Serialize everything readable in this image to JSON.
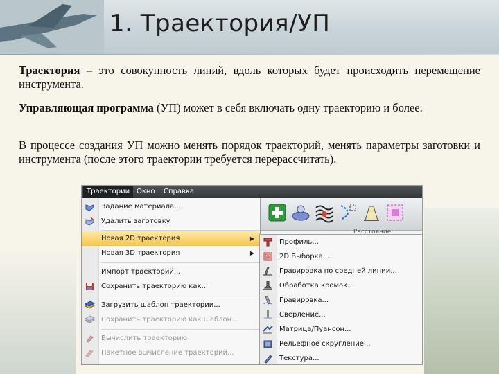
{
  "slide": {
    "title": "1. Траектория/УП",
    "paragraphs": [
      {
        "term": "Траектория",
        "text": " – это совокупность линий, вдоль которых будет происходить перемещение инструмента."
      },
      {
        "term": "Управляющая программа",
        "text": " (УП) может в себя включать одну траекторию и более."
      },
      {
        "term": "",
        "text": "В процессе создания УП можно менять порядок траекторий, менять параметры заготовки и инструмента (после этого траектории требуется перерассчитать)."
      }
    ]
  },
  "app": {
    "menubar": [
      "Траектории",
      "Окно",
      "Справка"
    ],
    "toolbar_label": "Расстояние",
    "menu": [
      {
        "label": "Задание материала...",
        "icon": "material-icon",
        "enabled": true
      },
      {
        "label": "Удалить заготовку",
        "icon": "delete-blank-icon",
        "enabled": true
      },
      {
        "label": "Новая 2D траектория",
        "icon": "",
        "enabled": true,
        "submenu": true,
        "highlighted": true
      },
      {
        "label": "Новая 3D траектория",
        "icon": "",
        "enabled": true,
        "submenu": true
      },
      {
        "label": "Импорт траекторий...",
        "icon": "",
        "enabled": true
      },
      {
        "label": "Сохранить траекторию как...",
        "icon": "save-icon",
        "enabled": true
      },
      {
        "label": "Загрузить шаблон траектории...",
        "icon": "load-template-icon",
        "enabled": true
      },
      {
        "label": "Сохранить траекторию как шаблон...",
        "icon": "save-template-icon",
        "enabled": false
      },
      {
        "label": "Вычислить траекторию",
        "icon": "compute-icon",
        "enabled": false
      },
      {
        "label": "Пакетное вычисление траекторий...",
        "icon": "batch-compute-icon",
        "enabled": false
      }
    ],
    "submenu": [
      {
        "label": "Профиль...",
        "icon": "profile-icon"
      },
      {
        "label": "2D Выборка...",
        "icon": "pocket-icon"
      },
      {
        "label": "Гравировка по средней линии...",
        "icon": "centerline-engrave-icon"
      },
      {
        "label": "Обработка кромок...",
        "icon": "edge-icon"
      },
      {
        "label": "Гравировка...",
        "icon": "engrave-icon"
      },
      {
        "label": "Сверление...",
        "icon": "drill-icon"
      },
      {
        "label": "Матрица/Пуансон...",
        "icon": "matrix-icon"
      },
      {
        "label": "Рельефное скругление...",
        "icon": "relief-fillet-icon"
      },
      {
        "label": "Текстура...",
        "icon": "texture-icon"
      }
    ]
  }
}
